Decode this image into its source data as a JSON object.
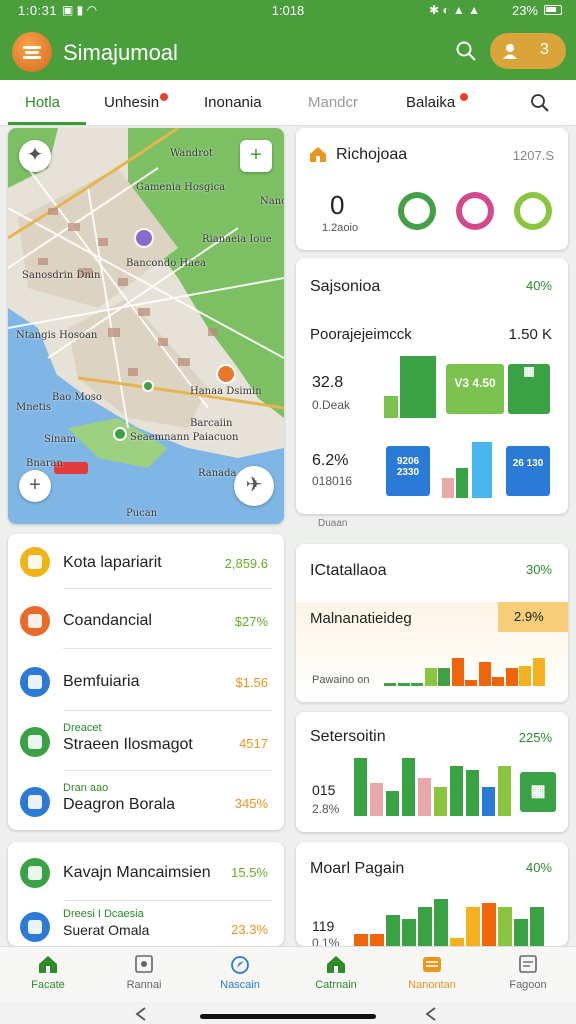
{
  "status": {
    "time_left": "1:0:31",
    "time_center": "1:018",
    "battery": "23%"
  },
  "app": {
    "title": "Simajumoal",
    "pill_count": "3"
  },
  "tabs": [
    {
      "label": "Hotla"
    },
    {
      "label": "Unhesin"
    },
    {
      "label": "Inonania"
    },
    {
      "label": "Mandcr"
    },
    {
      "label": "Balaika"
    }
  ],
  "map": {
    "labels": [
      "Wandrot",
      "Gamenia Hosgica",
      "Nanc",
      "Rianaeia Ioue",
      "Bancondo Haea",
      "Sanosdrin Dnin",
      "Ntangis Hosoan",
      "Bao Moso",
      "Mnetis",
      "Sinam",
      "Bnaran",
      "Barcaiin",
      "Hanaa Dsimin",
      "Seaemnann Paiacuon",
      "Ranada",
      "Pucan"
    ]
  },
  "list1": [
    {
      "label": "Kota lapariarit",
      "value": "2,859.6",
      "color": "#f1b418"
    },
    {
      "label": "Coandancial",
      "value": "$27%",
      "color": "#ea6a2a"
    },
    {
      "label": "Bemfuiaria",
      "value": "$1.56",
      "color": "#2a7ad6"
    },
    {
      "sub": "Dreacet",
      "label": "Straeen Ilosmagot",
      "value": "4517",
      "color": "#3aa245"
    },
    {
      "sub": "Dran aao",
      "label": "Deagron Borala",
      "value": "345%",
      "color": "#2a7ad6"
    }
  ],
  "list2": [
    {
      "label": "Kavajn Mancaimsien",
      "value": "15.5%",
      "color": "#3aa245"
    },
    {
      "sub": "Dreesi I Dcaesia",
      "label": "Suerat Omala",
      "value": "23.3%",
      "color": "#2a7ad6"
    }
  ],
  "card_summary": {
    "title": "Richojoaa",
    "date": "1207.S",
    "big": "0",
    "sub": "1.2aoio",
    "rings": [
      {
        "color": "#43a047"
      },
      {
        "color": "#d24a8c"
      },
      {
        "color": "#8bc53f"
      }
    ]
  },
  "card_stats": {
    "title": "Sajsonioa",
    "pct": "40%",
    "row1_label": "Poorajejeimcck",
    "row1_value": "1.50 K",
    "row2_big": "32.8",
    "row2_sub": "0.Deak",
    "row3_big": "6.2%",
    "row3_sub": "018016",
    "tile_a": "V3 4.50",
    "tile_b": "9206 2330",
    "tile_c": "26 130",
    "footnote": "Duaan"
  },
  "card_trend": {
    "title": "ICtatallaoa",
    "pct": "30%",
    "subtitle": "Malnanatieideg",
    "badge": "2.9%",
    "caption": "Pawaino on",
    "bars": [
      0.05,
      0.05,
      0.05,
      0.3,
      0.3,
      0.45,
      0.1,
      0.4,
      0.15,
      0.3,
      0.32,
      0.45
    ],
    "colors": [
      "#43a047",
      "#43a047",
      "#43a047",
      "#8bc53f",
      "#43a047",
      "#f0640c",
      "#f0640c",
      "#f0640c",
      "#f0640c",
      "#f0640c",
      "#f6b120",
      "#f6b120"
    ]
  },
  "card_bars": {
    "title": "Setersoitin",
    "pct": "225%",
    "left_value": "015",
    "left_sub": "2.8%",
    "bars": [
      0.7,
      0.4,
      0.3,
      0.7,
      0.45,
      0.35,
      0.6,
      0.55,
      0.35,
      0.6
    ],
    "colors": [
      "#3aa245",
      "#e9a8a8",
      "#3aa245",
      "#3aa245",
      "#e9a8a8",
      "#8bc53f",
      "#3aa245",
      "#3aa245",
      "#2a7ad6",
      "#8bc53f"
    ]
  },
  "card_mixed": {
    "title": "Moarl Pagain",
    "pct": "40%",
    "left_value": "119",
    "left_sub": "0.1%",
    "bars": [
      0.15,
      0.15,
      0.4,
      0.35,
      0.5,
      0.6,
      0.1,
      0.5,
      0.55,
      0.5,
      0.35,
      0.5
    ],
    "colors": [
      "#f0640c",
      "#f0640c",
      "#3aa245",
      "#3aa245",
      "#3aa245",
      "#3aa245",
      "#f6b120",
      "#f6b120",
      "#f0640c",
      "#8bc53f",
      "#3aa245",
      "#3aa245"
    ]
  },
  "nav": [
    {
      "label": "Facate",
      "color": "#2e8a2b"
    },
    {
      "label": "Rannai",
      "color": "#666666"
    },
    {
      "label": "Nascain",
      "color": "#2a7ad6"
    },
    {
      "label": "Catrnain",
      "color": "#2e8a2b"
    },
    {
      "label": "Nanontan",
      "color": "#e8961c"
    },
    {
      "label": "Fagoon",
      "color": "#666666"
    }
  ]
}
